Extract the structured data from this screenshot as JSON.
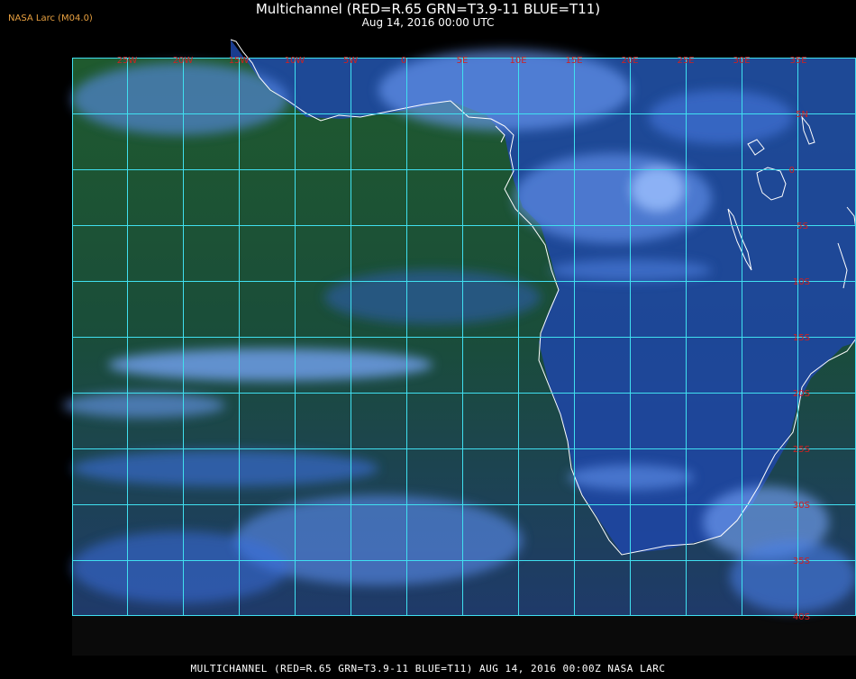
{
  "header": {
    "credit": "NASA Larc (M04.0)",
    "title": "Multichannel (RED=R.65 GRN=T3.9-11 BLUE=T11)",
    "timestamp": "Aug 14, 2016 00:00 UTC"
  },
  "map": {
    "longitude_labels": [
      "25W",
      "20W",
      "15W",
      "10W",
      "5W",
      "0",
      "5E",
      "10E",
      "15E",
      "20E",
      "25E",
      "30E",
      "35E"
    ],
    "latitude_labels": [
      "5N",
      "0",
      "5S",
      "10S",
      "15S",
      "20S",
      "25S",
      "30S",
      "35S",
      "40S"
    ],
    "grid_color": "#40e0f0",
    "label_color": "#d02020",
    "coast_color": "#ffffff",
    "ocean_color": "#1a4a3a",
    "cloud_color": "#3b6fe0"
  },
  "footer": {
    "caption": "MULTICHANNEL (RED=R.65 GRN=T3.9-11 BLUE=T11) AUG 14, 2016 00:00Z   NASA LARC"
  }
}
